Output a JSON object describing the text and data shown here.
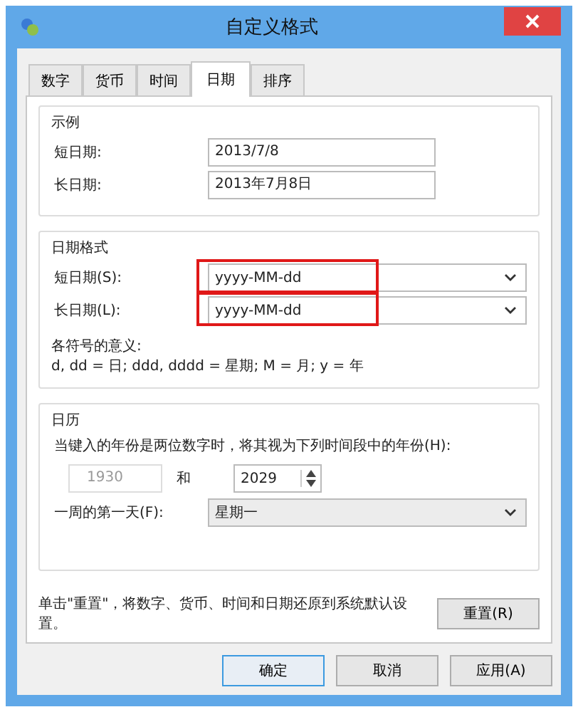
{
  "window": {
    "title": "自定义格式"
  },
  "tabs": [
    {
      "label": "数字",
      "selected": false
    },
    {
      "label": "货币",
      "selected": false
    },
    {
      "label": "时间",
      "selected": false
    },
    {
      "label": "日期",
      "selected": true
    },
    {
      "label": "排序",
      "selected": false
    }
  ],
  "example": {
    "title": "示例",
    "rows": [
      {
        "label": "短日期:",
        "value": "2013/7/8"
      },
      {
        "label": "长日期:",
        "value": "2013年7月8日"
      }
    ]
  },
  "date_formats": {
    "title": "日期格式",
    "rows": [
      {
        "label": "短日期(S):",
        "value": "yyyy-MM-dd",
        "highlighted": true
      },
      {
        "label": "长日期(L):",
        "value": "yyyy-MM-dd",
        "highlighted": true
      }
    ],
    "legend_title": "各符号的意义:",
    "legend": "d, dd = 日;  ddd, dddd = 星期;  M = 月;  y = 年"
  },
  "calendar": {
    "title": "日历",
    "two_digit_label": "当键入的年份是两位数字时，将其视为下列时间段中的年份(H):",
    "year_from": {
      "value": "1930",
      "disabled": true
    },
    "and": "和",
    "year_to": {
      "value": "2029",
      "disabled": false
    },
    "first_day_label": "一周的第一天(F):",
    "first_day": "星期一"
  },
  "reset_note": "单击\"重置\"，将数字、货币、时间和日期还原到系统默认设置。",
  "reset_button": "重置(R)",
  "buttons": [
    "确定",
    "取消",
    "应用(A)"
  ]
}
